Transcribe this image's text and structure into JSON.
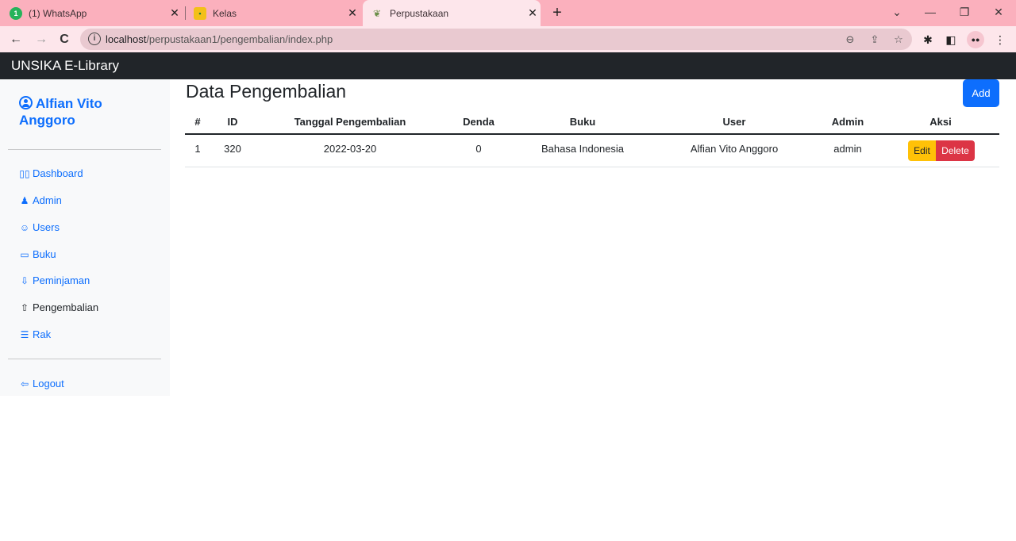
{
  "browser": {
    "tabs": [
      {
        "title": "(1) WhatsApp"
      },
      {
        "title": "Kelas"
      },
      {
        "title": "Perpustakaan"
      }
    ],
    "url_host": "localhost",
    "url_path": "/perpustakaan1/pengembalian/index.php"
  },
  "app": {
    "brand": "UNSIKA E-Library"
  },
  "sidebar": {
    "user_first": "Alfian Vito",
    "user_last": "Anggoro",
    "items": [
      {
        "label": "Dashboard",
        "icon": "dashboard-icon"
      },
      {
        "label": "Admin",
        "icon": "admin-icon"
      },
      {
        "label": "Users",
        "icon": "users-icon"
      },
      {
        "label": "Buku",
        "icon": "book-icon"
      },
      {
        "label": "Peminjaman",
        "icon": "borrow-icon"
      },
      {
        "label": "Pengembalian",
        "icon": "return-icon"
      },
      {
        "label": "Rak",
        "icon": "shelf-icon"
      }
    ],
    "logout": "Logout"
  },
  "main": {
    "title": "Data Pengembalian",
    "add_label": "Add",
    "columns": [
      "#",
      "ID",
      "Tanggal Pengembalian",
      "Denda",
      "Buku",
      "User",
      "Admin",
      "Aksi"
    ],
    "rows": [
      {
        "no": "1",
        "id": "320",
        "tanggal": "2022-03-20",
        "denda": "0",
        "buku": "Bahasa Indonesia",
        "user": "Alfian Vito Anggoro",
        "admin": "admin",
        "edit": "Edit",
        "delete": "Delete"
      }
    ]
  },
  "colors": {
    "primary": "#0d6efd",
    "navbar": "#212529",
    "edit": "#ffc107",
    "delete": "#dc3545",
    "tabstrip": "#fbb0bd"
  }
}
